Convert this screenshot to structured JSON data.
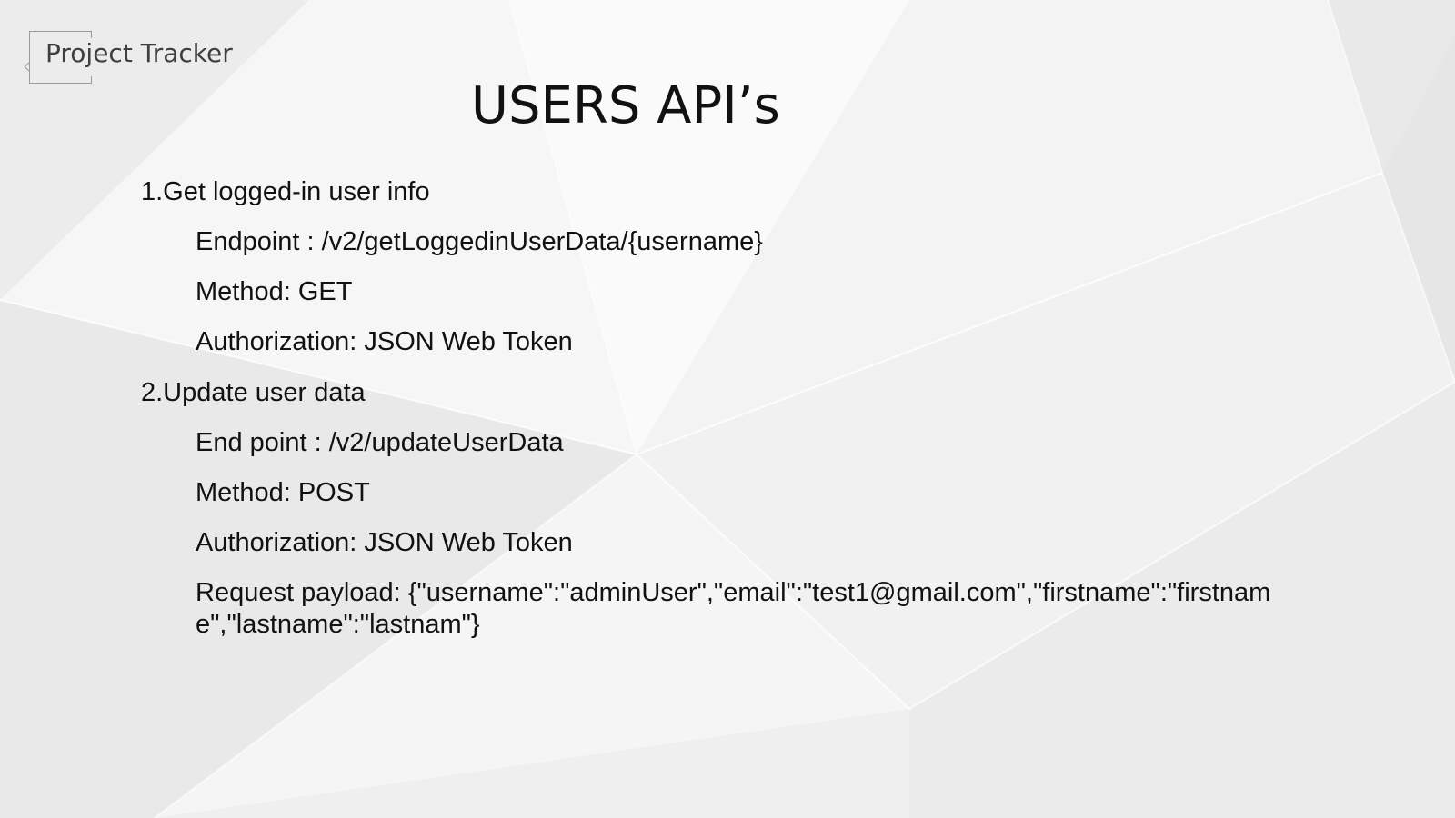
{
  "header": {
    "brand": "Project Tracker",
    "title": "USERS API’s"
  },
  "sections": [
    {
      "heading": "1.Get logged-in user info",
      "endpoint_label": "Endpoint : ",
      "endpoint_value": "/v2/getLoggedinUserData/{username}",
      "method": "Method: GET",
      "authorization": "Authorization: JSON Web Token"
    },
    {
      "heading": "2.Update user data",
      "endpoint_label": "End point : ",
      "endpoint_value": "/v2/updateUserData",
      "method": "Method: POST",
      "authorization": "Authorization: JSON Web Token",
      "payload_label": "Request payload: ",
      "payload_value": "{\"username\":\"adminUser\",\"email\":\"test1@gmail.com\",\"firstname\":\"firstname\",\"lastname\":\"lastnam\"}"
    }
  ],
  "colors": {
    "background": "#f2f2f2",
    "text": "#111111",
    "brand_text": "#3f3f3f"
  }
}
